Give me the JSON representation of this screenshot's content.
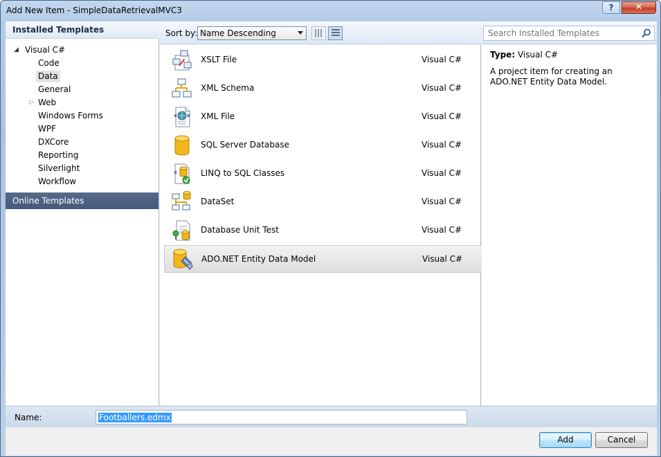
{
  "window": {
    "title": "Add New Item - SimpleDataRetrievalMVC3",
    "help_glyph": "?",
    "close_glyph": "✕"
  },
  "left": {
    "installed_header": "Installed Templates",
    "tree": [
      {
        "label": "Visual C#",
        "level": 0,
        "expanded": true
      },
      {
        "label": "Code",
        "level": 1
      },
      {
        "label": "Data",
        "level": 1,
        "selected": true
      },
      {
        "label": "General",
        "level": 1
      },
      {
        "label": "Web",
        "level": 1,
        "collapsible": true
      },
      {
        "label": "Windows Forms",
        "level": 1
      },
      {
        "label": "WPF",
        "level": 1
      },
      {
        "label": "DXCore",
        "level": 1
      },
      {
        "label": "Reporting",
        "level": 1
      },
      {
        "label": "Silverlight",
        "level": 1
      },
      {
        "label": "Workflow",
        "level": 1
      }
    ],
    "online_templates": "Online Templates"
  },
  "toolbar": {
    "sort_label": "Sort by:",
    "sort_value": "Name Descending"
  },
  "templates": [
    {
      "name": "XSLT File",
      "lang": "Visual C#",
      "icon": "xslt-file-icon"
    },
    {
      "name": "XML Schema",
      "lang": "Visual C#",
      "icon": "xml-schema-icon"
    },
    {
      "name": "XML File",
      "lang": "Visual C#",
      "icon": "xml-file-icon"
    },
    {
      "name": "SQL Server Database",
      "lang": "Visual C#",
      "icon": "sql-database-icon"
    },
    {
      "name": "LINQ to SQL Classes",
      "lang": "Visual C#",
      "icon": "linq-to-sql-icon"
    },
    {
      "name": "DataSet",
      "lang": "Visual C#",
      "icon": "dataset-icon"
    },
    {
      "name": "Database Unit Test",
      "lang": "Visual C#",
      "icon": "database-unit-test-icon"
    },
    {
      "name": "ADO.NET Entity Data Model",
      "lang": "Visual C#",
      "icon": "entity-data-model-icon",
      "selected": true
    }
  ],
  "search": {
    "placeholder": "Search Installed Templates"
  },
  "details": {
    "type_label": "Type:",
    "type_value": "Visual C#",
    "description": "A project item for creating an ADO.NET Entity Data Model."
  },
  "bottom": {
    "name_label": "Name:",
    "name_value": "Footballers.edmx",
    "add_label": "Add",
    "cancel_label": "Cancel"
  },
  "colors": {
    "selection_online": "#4a5e7f",
    "accent_blue": "#3399ff"
  }
}
